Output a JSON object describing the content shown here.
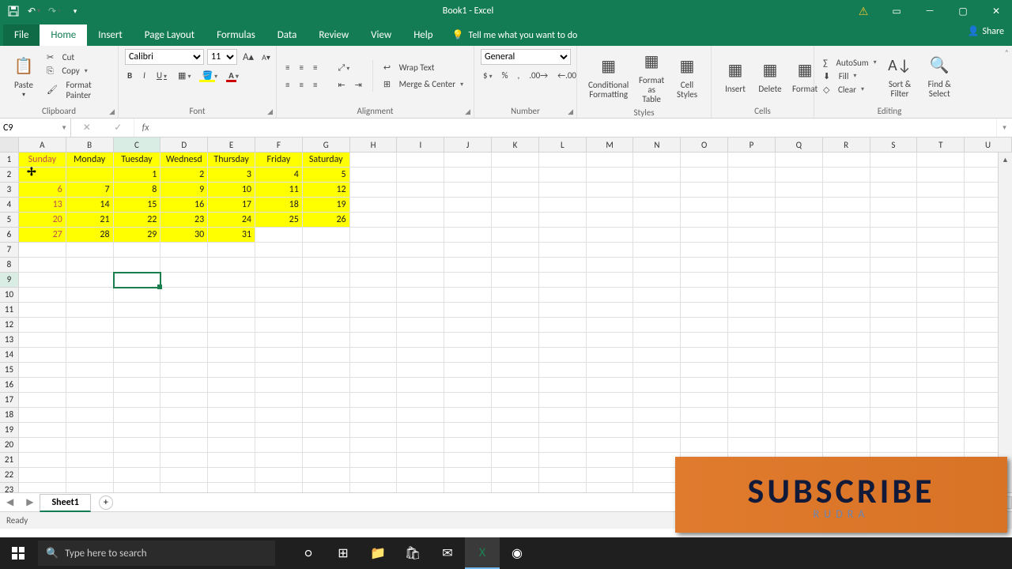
{
  "app": {
    "title": "Book1 - Excel"
  },
  "qat": {
    "save": "💾",
    "undo": "↶",
    "redo": "↷"
  },
  "tabs": {
    "file": "File",
    "home": "Home",
    "insert": "Insert",
    "pagelayout": "Page Layout",
    "formulas": "Formulas",
    "data": "Data",
    "review": "Review",
    "view": "View",
    "help": "Help",
    "tellme": "Tell me what you want to do",
    "share": "Share"
  },
  "ribbon": {
    "clipboard": {
      "label": "Clipboard",
      "paste": "Paste",
      "cut": "Cut",
      "copy": "Copy",
      "painter": "Format Painter"
    },
    "font": {
      "label": "Font",
      "name": "Calibri",
      "size": "11",
      "bold": "B",
      "italic": "I",
      "underline": "U",
      "incsize": "A",
      "decsize": "A"
    },
    "alignment": {
      "label": "Alignment",
      "wrap": "Wrap Text",
      "merge": "Merge & Center"
    },
    "number": {
      "label": "Number",
      "format": "General"
    },
    "styles": {
      "label": "Styles",
      "cond": "Conditional Formatting",
      "table": "Format as Table",
      "cell": "Cell Styles"
    },
    "cells": {
      "label": "Cells",
      "insert": "Insert",
      "delete": "Delete",
      "format": "Format"
    },
    "editing": {
      "label": "Editing",
      "autosum": "AutoSum",
      "fill": "Fill",
      "clear": "Clear",
      "sort": "Sort & Filter",
      "find": "Find & Select"
    }
  },
  "namebox": "C9",
  "formula": "",
  "columns": [
    "A",
    "B",
    "C",
    "D",
    "E",
    "F",
    "G",
    "H",
    "I",
    "J",
    "K",
    "L",
    "M",
    "N",
    "O",
    "P",
    "Q",
    "R",
    "S",
    "T",
    "U"
  ],
  "rows": 23,
  "selected": {
    "col": "C",
    "row": 9
  },
  "sheetdata": {
    "headers": [
      "Sunday",
      "Monday",
      "Tuesday",
      "Wednesd",
      "Thursday",
      "Friday",
      "Saturday"
    ],
    "rows": [
      [
        "",
        "",
        "1",
        "2",
        "3",
        "4",
        "5"
      ],
      [
        "6",
        "7",
        "8",
        "9",
        "10",
        "11",
        "12"
      ],
      [
        "13",
        "14",
        "15",
        "16",
        "17",
        "18",
        "19"
      ],
      [
        "20",
        "21",
        "22",
        "23",
        "24",
        "25",
        "26"
      ],
      [
        "27",
        "28",
        "29",
        "30",
        "31",
        "",
        ""
      ]
    ]
  },
  "sheets": {
    "active": "Sheet1"
  },
  "status": "Ready",
  "taskbar": {
    "search_placeholder": "Type here to search"
  },
  "overlay": {
    "big": "SUBSCRIBE",
    "small": "RUDRA"
  }
}
